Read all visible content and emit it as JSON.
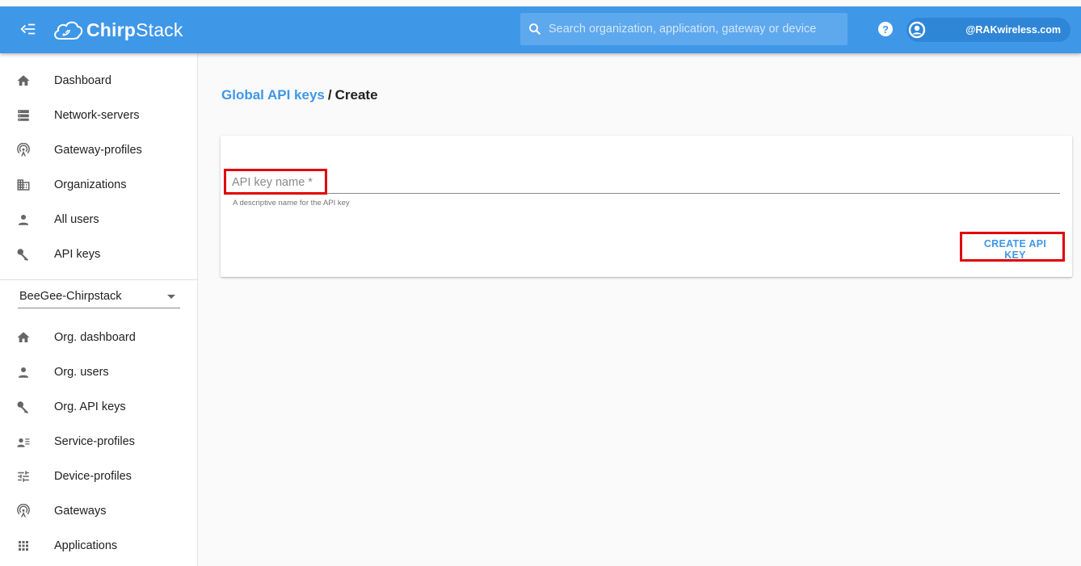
{
  "topbar": {
    "brand_bold": "Chirp",
    "brand_light": "Stack",
    "search_placeholder": "Search organization, application, gateway or device",
    "user_name": "@RAKwireless.com",
    "color": "#3f97e8"
  },
  "sidebar": {
    "global_items": [
      {
        "label": "Dashboard",
        "icon": "home-icon"
      },
      {
        "label": "Network-servers",
        "icon": "server-icon"
      },
      {
        "label": "Gateway-profiles",
        "icon": "antenna-icon"
      },
      {
        "label": "Organizations",
        "icon": "domain-icon"
      },
      {
        "label": "All users",
        "icon": "user-icon"
      },
      {
        "label": "API keys",
        "icon": "key-icon"
      }
    ],
    "org_selector": "BeeGee-Chirpstack",
    "org_items": [
      {
        "label": "Org. dashboard",
        "icon": "home-icon"
      },
      {
        "label": "Org. users",
        "icon": "user-icon"
      },
      {
        "label": "Org. API keys",
        "icon": "key-icon"
      },
      {
        "label": "Service-profiles",
        "icon": "account-details-icon"
      },
      {
        "label": "Device-profiles",
        "icon": "tune-icon"
      },
      {
        "label": "Gateways",
        "icon": "antenna-icon"
      },
      {
        "label": "Applications",
        "icon": "apps-icon"
      }
    ]
  },
  "breadcrumb": {
    "link": "Global API keys",
    "separator": "/",
    "current": "Create"
  },
  "form": {
    "field_placeholder": "API key name *",
    "field_helper": "A descriptive name for the API key",
    "submit_label": "CREATE API KEY"
  },
  "annotation_color": "#e00000"
}
